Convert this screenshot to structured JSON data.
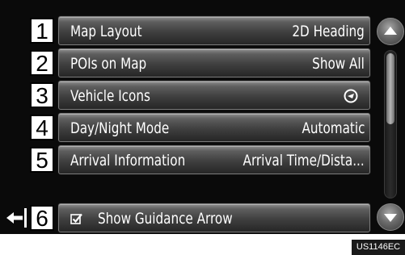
{
  "menu": {
    "items": [
      {
        "number": "1",
        "label": "Map Layout",
        "value": "2D Heading"
      },
      {
        "number": "2",
        "label": "POIs on Map",
        "value": "Show All"
      },
      {
        "number": "3",
        "label": "Vehicle Icons",
        "value_icon": "vehicle-icon"
      },
      {
        "number": "4",
        "label": "Day/Night Mode",
        "value": "Automatic"
      },
      {
        "number": "5",
        "label": "Arrival Information",
        "value": "Arrival Time/Dista..."
      },
      {
        "number": "6",
        "label": "Show Guidance Arrow",
        "checked": true
      }
    ]
  },
  "icons": {
    "scroll_up": "triangle-up-icon",
    "scroll_down": "triangle-down-icon",
    "back": "back-arrow-icon",
    "check": "checkbox-checked-icon"
  },
  "footer": {
    "code": "US1146EC"
  },
  "colors": {
    "background": "#0a0a0a",
    "button_text": "#ffffff",
    "number_box": "#ffffff"
  }
}
